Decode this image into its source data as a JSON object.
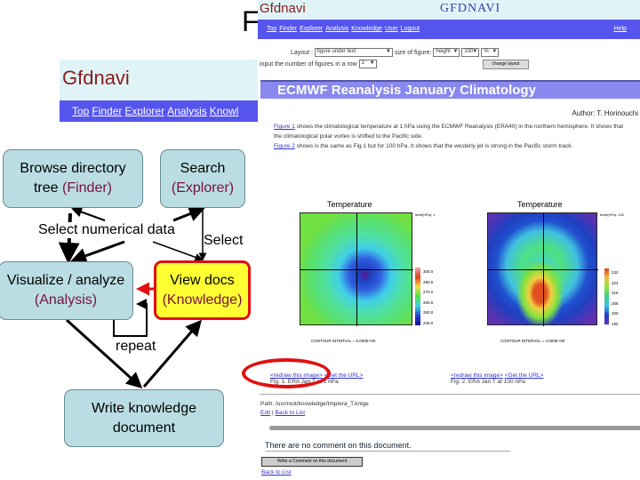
{
  "slide": {
    "title_fragment": "F"
  },
  "diagram": {
    "browse": {
      "line1": "Browse directory",
      "line2a": "tree ",
      "line2b": "(Finder)"
    },
    "search": {
      "line1": "Search",
      "line2": "(Explorer)"
    },
    "select_numerical": "Select numerical data",
    "select": "Select",
    "visualize": {
      "line1": "Visualize / analyze",
      "line2": "(Analysis)"
    },
    "view_docs": {
      "line1": "View docs",
      "line2": "(Knowledge)"
    },
    "repeat": "repeat",
    "write": {
      "line1": "Write knowledge",
      "line2": "document"
    },
    "colors": {
      "box": "#b9dde2",
      "highlight": "#ffff33",
      "highlight_border": "#e01010",
      "accent_text": "#7a1040"
    }
  },
  "inset": {
    "logo": "Gfdnavi",
    "nav": [
      "Top",
      "Finder",
      "Explorer",
      "Analysis",
      "Knowl"
    ]
  },
  "browser": {
    "logo": "Gfdnavi",
    "header_title": "GFDNAVI",
    "nav": [
      "Top",
      "Finder",
      "Explorer",
      "Analysis",
      "Knowledge",
      "User",
      "Logout"
    ],
    "help": "Help",
    "layout_label": "Layout :",
    "layout_value": "figure under text",
    "size_label": "size of figure:",
    "size_dim": "height",
    "size_value": "100",
    "size_unit": "%",
    "row_label": "input the number of figures in a row",
    "row_value": "2",
    "change_layout": "change layout",
    "doc_title": "ECMWF Reanalysis January Climatology",
    "author": "Author: T. Horinouchi",
    "p1_link": "Figure 1",
    "p1": " shows the climatological temperature at 1 hPa using the ECMWF Reanalysis (ERA40) in the northern hemisphere. It shows that the climatological polar vortex is shifted to the Pacific side.",
    "p2_link": "Figure 2",
    "p2": " shows is the same as Fig.1 but for 100 hPa. It shows that the westerly jet is strong in the Pacific storm track.",
    "figures": [
      {
        "title": "Temperature",
        "level": "level(hPa): 1",
        "legend": [
          "300.0",
          "290.0",
          "270.0",
          "260.0",
          "250.0",
          "240.0"
        ],
        "contour": "CONTOUR INTERVAL = 5.000E+00",
        "redraw": "<redraw this image>",
        "url": "<Get the URL>",
        "caption": "Fig. 1. ERA Jan T at 1 hPa"
      },
      {
        "title": "Temperature",
        "level": "level(hPa): 100",
        "legend": [
          "232",
          "224",
          "216",
          "208",
          "200",
          "192"
        ],
        "contour": "CONTOUR INTERVAL = 4.000E+00",
        "redraw": "<redraw this image>",
        "url": "<Get the URL>",
        "caption": "Fig. 2. ERA Jan T at 100 hPa"
      }
    ],
    "path": "Path: /usr/root/knowledge/tmp/era_T.knlge",
    "edit": "Edit",
    "back_to_list": "Back to List",
    "no_comment": "There are no comment on this document.",
    "write_comment": "Write a Comment on this document",
    "back_to_list2": "Back to List"
  }
}
